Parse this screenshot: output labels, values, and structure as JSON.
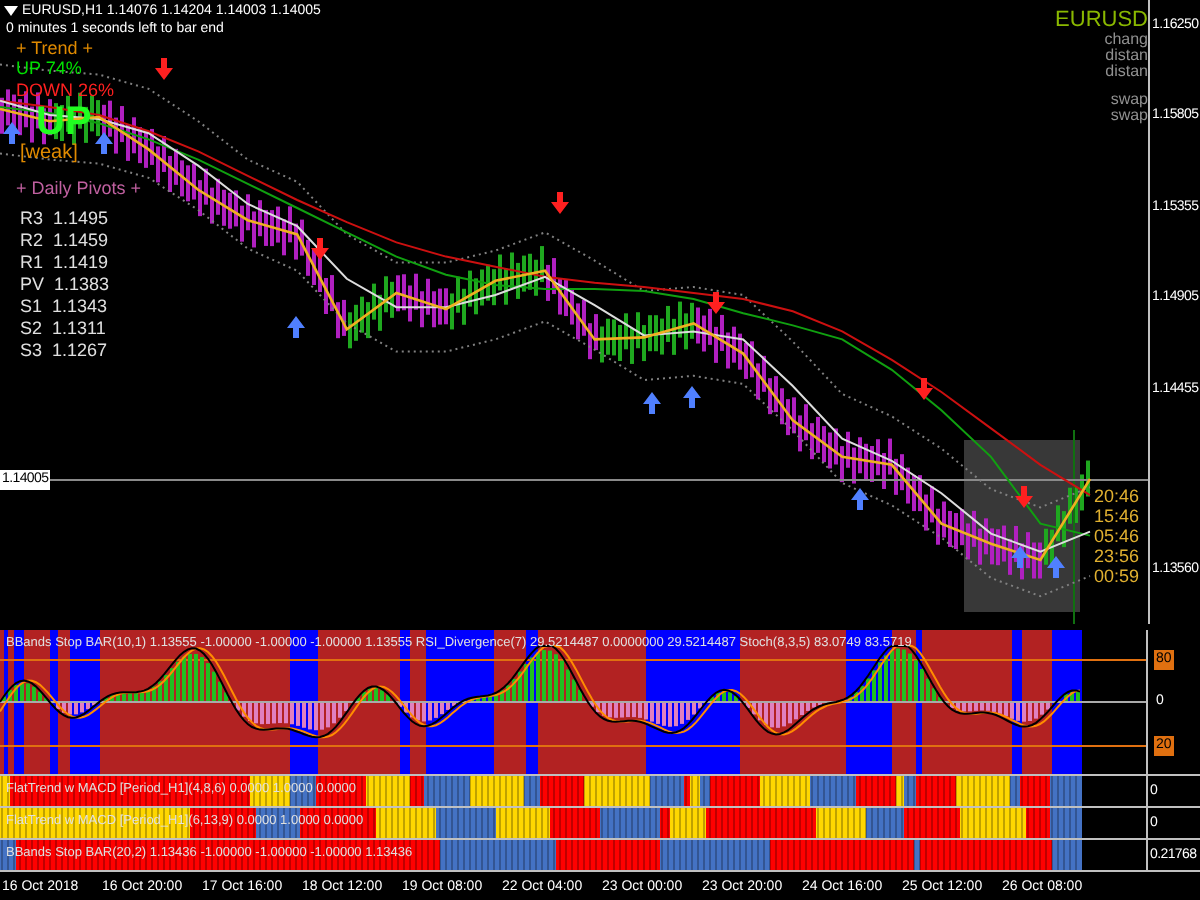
{
  "chart": {
    "symbol_line": "EURUSD,H1  1.14076 1.14204 1.14003 1.14005",
    "timer": "0 minutes 1 seconds left to bar end",
    "trend": {
      "title": "+ Trend +",
      "up": "UP 74%",
      "down": "DOWN 26%",
      "signal": "UP",
      "strength": "[weak]"
    },
    "pivots": {
      "title": "+ Daily Pivots +",
      "levels": [
        {
          "label": "R3",
          "value": "1.1495"
        },
        {
          "label": "R2",
          "value": "1.1459"
        },
        {
          "label": "R1",
          "value": "1.1419"
        },
        {
          "label": "PV",
          "value": "1.1383"
        },
        {
          "label": "S1",
          "value": "1.1343"
        },
        {
          "label": "S2",
          "value": "1.1311"
        },
        {
          "label": "S3",
          "value": "1.1267"
        }
      ]
    },
    "info": {
      "symbol": "EURUSD",
      "labels": [
        "chang",
        "distan",
        "distan",
        "swap",
        "swap"
      ]
    },
    "timers": [
      "20:46",
      "15:46",
      "05:46",
      "23:56",
      "00:59"
    ],
    "current_price": "1.14005",
    "chart_data": {
      "type": "line",
      "ylim": [
        1.13293,
        1.16379
      ],
      "yticks": [
        {
          "value": 1.1625,
          "label": "1.16250"
        },
        {
          "value": 1.15805,
          "label": "1.15805"
        },
        {
          "value": 1.15355,
          "label": "1.15355"
        },
        {
          "value": 1.14905,
          "label": "1.14905"
        },
        {
          "value": 1.14455,
          "label": "1.14455"
        },
        {
          "value": 1.1356,
          "label": "1.13560"
        }
      ],
      "series": [
        {
          "line_style": "dotted",
          "color": "#808080",
          "values": [
            1.1606,
            1.1603,
            1.1601,
            1.1594,
            1.1578,
            1.1559,
            1.1548,
            1.1522,
            1.1508,
            1.1508,
            1.1514,
            1.1523,
            1.1509,
            1.1494,
            1.1496,
            1.1492,
            1.1469,
            1.1443,
            1.1432,
            1.1416,
            1.1396,
            1.1387,
            1.1397
          ]
        },
        {
          "line_style": "dotted",
          "color": "#808080",
          "values": [
            1.1562,
            1.1559,
            1.1557,
            1.155,
            1.1534,
            1.1515,
            1.1504,
            1.1478,
            1.1464,
            1.1464,
            1.147,
            1.1479,
            1.1465,
            1.145,
            1.1452,
            1.1448,
            1.1425,
            1.1399,
            1.1388,
            1.1372,
            1.1352,
            1.1343,
            1.1353
          ]
        },
        {
          "line_style": "solid",
          "color": "#cc1010",
          "values": [
            1.1588,
            1.1585,
            1.1581,
            1.1573,
            1.1563,
            1.1551,
            1.1539,
            1.1528,
            1.1518,
            1.1511,
            1.1506,
            1.1501,
            1.1498,
            1.1496,
            1.1493,
            1.149,
            1.1484,
            1.1474,
            1.146,
            1.1444,
            1.1426,
            1.1408,
            1.1393
          ]
        },
        {
          "line_style": "solid",
          "color": "#10a010",
          "values": [
            1.1585,
            1.1582,
            1.1577,
            1.1569,
            1.1559,
            1.1547,
            1.1535,
            1.1523,
            1.1511,
            1.1502,
            1.1497,
            1.1495,
            1.1495,
            1.1494,
            1.149,
            1.1483,
            1.1477,
            1.147,
            1.1455,
            1.1435,
            1.1412,
            1.1379,
            1.1373
          ]
        },
        {
          "line_style": "solid",
          "color": "#dddddd",
          "values": [
            1.1588,
            1.1581,
            1.1579,
            1.1572,
            1.1556,
            1.1537,
            1.1526,
            1.15,
            1.1486,
            1.1486,
            1.1492,
            1.1501,
            1.1487,
            1.1472,
            1.1474,
            1.147,
            1.1447,
            1.1421,
            1.141,
            1.1394,
            1.1374,
            1.1365,
            1.1375
          ]
        },
        {
          "line_style": "solid",
          "color": "#f0b020",
          "values": [
            1.1584,
            1.1578,
            1.158,
            1.1564,
            1.1544,
            1.1529,
            1.1522,
            1.1475,
            1.1493,
            1.1485,
            1.1499,
            1.1504,
            1.147,
            1.1471,
            1.1478,
            1.1463,
            1.143,
            1.1412,
            1.1408,
            1.1379,
            1.1369,
            1.1361,
            1.1401
          ]
        }
      ]
    }
  },
  "oscillator": {
    "legend": "BBands Stop BAR(10,1) 1.13555 -1.00000 -1.00000 -1.00000 1.13555  RSI_Divergence(7) 29.5214487 0.0000000 29.5214487  Stoch(8,3,5) 83.0749 83.5719",
    "axis": [
      "80",
      "0",
      "20"
    ]
  },
  "bar_panels": [
    {
      "legend": "FlatTrend w MACD [Period_H1](4,8,6) 0.0000 1.0000 0.0000",
      "reading": "0"
    },
    {
      "legend": "FlatTrend w MACD [Period_H1](6,13,9) 0.0000 1.0000 0.0000",
      "reading": "0"
    },
    {
      "legend": "BBands Stop BAR(20,2) 1.13436 -1.00000 -1.00000 -1.00000 1.13436",
      "reading": "0.21768"
    }
  ],
  "time_axis": [
    "16 Oct 2018",
    "16 Oct 20:00",
    "17 Oct 16:00",
    "18 Oct 12:00",
    "19 Oct 08:00",
    "22 Oct 04:00",
    "23 Oct 00:00",
    "23 Oct 20:00",
    "24 Oct 16:00",
    "25 Oct 12:00",
    "26 Oct 08:00"
  ]
}
